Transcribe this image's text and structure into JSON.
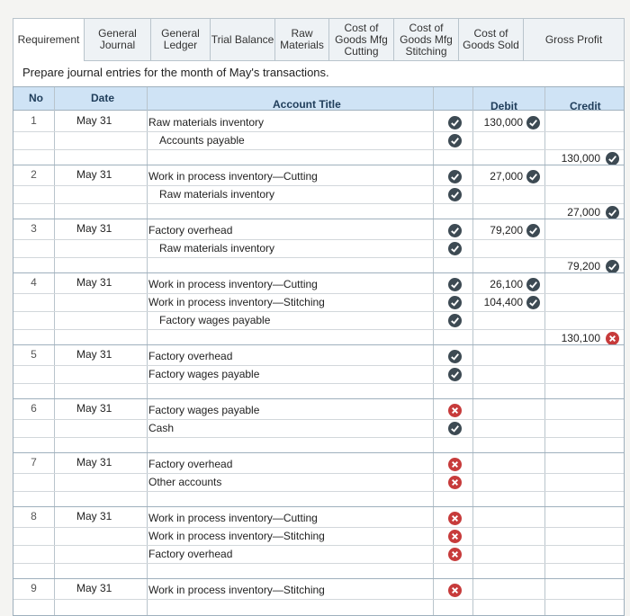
{
  "tabs": [
    {
      "label": "Requirement"
    },
    {
      "label": "General\nJournal"
    },
    {
      "label": "General\nLedger"
    },
    {
      "label": "Trial Balance"
    },
    {
      "label": "Raw\nMaterials"
    },
    {
      "label": "Cost of\nGoods Mfg\nCutting"
    },
    {
      "label": "Cost of\nGoods Mfg\nStitching"
    },
    {
      "label": "Cost of\nGoods Sold"
    },
    {
      "label": "Gross Profit"
    }
  ],
  "instruction": "Prepare journal entries for the month of May's transactions.",
  "headers": {
    "no": "No",
    "date": "Date",
    "account": "Account Title",
    "debit": "Debit",
    "credit": "Credit"
  },
  "entries": [
    {
      "no": "1",
      "date": "May 31",
      "lines": [
        {
          "account": "Raw materials inventory",
          "debit": "130,000",
          "credit": "",
          "account_mark": "ok",
          "debit_mark": "ok",
          "credit_mark": ""
        },
        {
          "account": "Accounts payable",
          "debit": "",
          "credit": "130,000",
          "account_mark": "ok",
          "debit_mark": "",
          "credit_mark": "ok"
        }
      ]
    },
    {
      "no": "2",
      "date": "May 31",
      "lines": [
        {
          "account": "Work in process inventory—Cutting",
          "debit": "27,000",
          "credit": "",
          "account_mark": "ok",
          "debit_mark": "ok",
          "credit_mark": ""
        },
        {
          "account": "Raw materials inventory",
          "debit": "",
          "credit": "27,000",
          "account_mark": "ok",
          "debit_mark": "",
          "credit_mark": "ok"
        }
      ]
    },
    {
      "no": "3",
      "date": "May 31",
      "lines": [
        {
          "account": "Factory overhead",
          "debit": "79,200",
          "credit": "",
          "account_mark": "ok",
          "debit_mark": "ok",
          "credit_mark": ""
        },
        {
          "account": "Raw materials inventory",
          "debit": "",
          "credit": "79,200",
          "account_mark": "ok",
          "debit_mark": "",
          "credit_mark": "ok"
        }
      ]
    },
    {
      "no": "4",
      "date": "May 31",
      "lines": [
        {
          "account": "Work in process inventory—Cutting",
          "debit": "26,100",
          "credit": "",
          "account_mark": "ok",
          "debit_mark": "ok",
          "credit_mark": ""
        },
        {
          "account": "Work in process inventory—Stitching",
          "debit": "104,400",
          "credit": "",
          "account_mark": "ok",
          "debit_mark": "ok",
          "credit_mark": ""
        },
        {
          "account": "Factory wages payable",
          "debit": "",
          "credit": "130,100",
          "account_mark": "ok",
          "debit_mark": "",
          "credit_mark": "bad"
        }
      ]
    },
    {
      "no": "5",
      "date": "May 31",
      "lines": [
        {
          "account": "Factory overhead",
          "debit": "",
          "credit": "",
          "account_mark": "ok",
          "debit_mark": "",
          "credit_mark": ""
        },
        {
          "account": "Factory wages payable",
          "debit": "",
          "credit": "",
          "account_mark": "ok",
          "debit_mark": "",
          "credit_mark": ""
        }
      ]
    },
    {
      "no": "6",
      "date": "May 31",
      "lines": [
        {
          "account": "Factory wages payable",
          "debit": "",
          "credit": "",
          "account_mark": "bad",
          "debit_mark": "",
          "credit_mark": ""
        },
        {
          "account": "Cash",
          "debit": "",
          "credit": "",
          "account_mark": "ok",
          "debit_mark": "",
          "credit_mark": ""
        }
      ]
    },
    {
      "no": "7",
      "date": "May 31",
      "lines": [
        {
          "account": "Factory overhead",
          "debit": "",
          "credit": "",
          "account_mark": "bad",
          "debit_mark": "",
          "credit_mark": ""
        },
        {
          "account": "Other accounts",
          "debit": "",
          "credit": "",
          "account_mark": "bad",
          "debit_mark": "",
          "credit_mark": ""
        }
      ]
    },
    {
      "no": "8",
      "date": "May 31",
      "lines": [
        {
          "account": "Work in process inventory—Cutting",
          "debit": "",
          "credit": "",
          "account_mark": "bad",
          "debit_mark": "",
          "credit_mark": ""
        },
        {
          "account": "Work in process inventory—Stitching",
          "debit": "",
          "credit": "",
          "account_mark": "bad",
          "debit_mark": "",
          "credit_mark": ""
        },
        {
          "account": "Factory overhead",
          "debit": "",
          "credit": "",
          "account_mark": "bad",
          "debit_mark": "",
          "credit_mark": ""
        }
      ]
    },
    {
      "no": "9",
      "date": "May 31",
      "lines": [
        {
          "account": "Work in process inventory—Stitching",
          "debit": "",
          "credit": "",
          "account_mark": "bad",
          "debit_mark": "",
          "credit_mark": ""
        }
      ]
    }
  ],
  "colors": {
    "header_bg": "#cfe3f5",
    "ok": "#3d4a53",
    "bad": "#c73b3b"
  }
}
